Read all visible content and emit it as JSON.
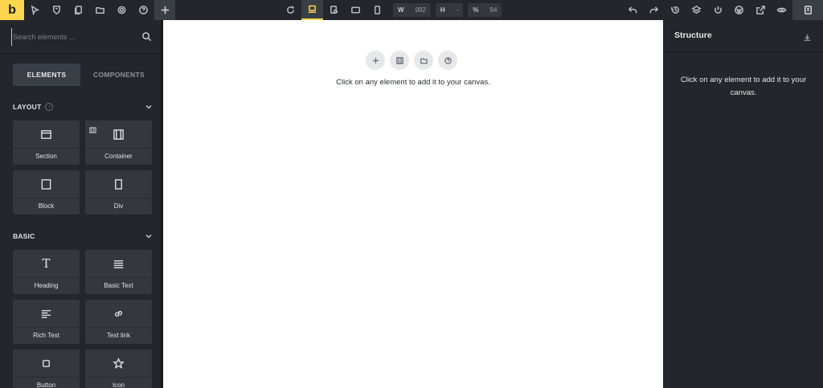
{
  "app": {
    "logo_letter": "b",
    "accent_color": "#ffd64f",
    "panel_color": "#23262a",
    "tile_color": "#34383e"
  },
  "toolbar": {
    "left_icons": [
      "pointer-icon",
      "shield-icon",
      "pages-icon",
      "folder-icon",
      "gear-icon",
      "help-icon"
    ],
    "add_icon": "plus-icon",
    "center_icons": [
      "refresh-icon",
      "desktop-icon",
      "laptop-icon",
      "tablet-landscape-icon",
      "phone-portrait-icon"
    ],
    "width": {
      "label": "W",
      "value": "992"
    },
    "height": {
      "label": "H",
      "value": "-"
    },
    "zoom": {
      "label": "%",
      "value": "94"
    },
    "right_icons": [
      "undo-icon",
      "redo-icon",
      "history-icon",
      "layers-icon",
      "power-icon",
      "wordpress-icon",
      "external-link-icon",
      "preview-eye-icon",
      "toggle-panel-icon"
    ]
  },
  "left_panel": {
    "search_placeholder": "Search elements ...",
    "tabs": [
      {
        "label": "ELEMENTS",
        "active": true
      },
      {
        "label": "COMPONENTS",
        "active": false
      }
    ],
    "sections": [
      {
        "title": "LAYOUT",
        "info": "i",
        "tiles": [
          {
            "label": "Section",
            "icon": "section-icon"
          },
          {
            "label": "Container",
            "icon": "container-icon"
          },
          {
            "label": "Block",
            "icon": "block-icon"
          },
          {
            "label": "Div",
            "icon": "div-icon"
          }
        ]
      },
      {
        "title": "BASIC",
        "tiles": [
          {
            "label": "Heading",
            "icon": "heading-icon",
            "glyph": "T"
          },
          {
            "label": "Basic Text",
            "icon": "basic-text-icon"
          },
          {
            "label": "Rich Text",
            "icon": "rich-text-icon"
          },
          {
            "label": "Text link",
            "icon": "link-icon"
          },
          {
            "label": "Button",
            "icon": "button-icon"
          },
          {
            "label": "Icon",
            "icon": "star-icon"
          }
        ]
      }
    ]
  },
  "canvas": {
    "actions": [
      "add-icon",
      "templates-icon",
      "folder-icon",
      "help-icon"
    ],
    "empty_message": "Click on any element to add it to your canvas."
  },
  "right_panel": {
    "title": "Structure",
    "empty_message": "Click on any element to add it to your canvas."
  }
}
